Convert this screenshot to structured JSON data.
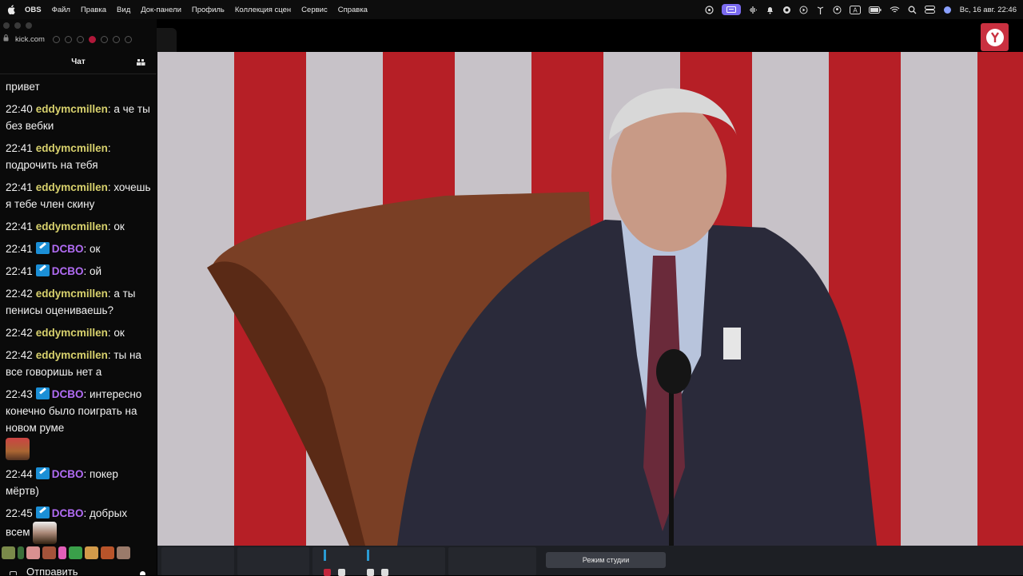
{
  "menubar": {
    "apple_icon": "apple-logo-icon",
    "app": "OBS",
    "items": [
      "Файл",
      "Правка",
      "Вид",
      "Док-панели",
      "Профиль",
      "Коллекция сцен",
      "Сервис",
      "Справка"
    ],
    "status_icons": [
      "obs-tray-icon",
      "screen-share-icon",
      "audio-wave-icon",
      "bell-icon",
      "chatgpt-icon",
      "play-circle-icon",
      "antenna-icon",
      "music-note-icon",
      "text-input-icon",
      "battery-icon",
      "wifi-icon",
      "search-icon",
      "control-center-icon",
      "siri-icon"
    ],
    "keyboard_label": "A",
    "clock": "Вс, 16 авг.  22:46"
  },
  "chat": {
    "url": "kick.com",
    "header_title": "Чат",
    "send_label": "Отправить",
    "messages": [
      {
        "text": "привет"
      },
      {
        "time": "22:40",
        "user": "eddymcmillen",
        "text": ": а че ты без вебки",
        "color": "#d8d16d"
      },
      {
        "time": "22:41",
        "user": "eddymcmillen",
        "text": ": подрочить на тебя",
        "color": "#d8d16d"
      },
      {
        "time": "22:41",
        "user": "eddymcmillen",
        "text": ": хочешь я тебе член скину",
        "color": "#d8d16d"
      },
      {
        "time": "22:41",
        "user": "eddymcmillen",
        "text": ": ок",
        "color": "#d8d16d"
      },
      {
        "time": "22:41",
        "user": "DCBO",
        "text": ": ок",
        "color": "#b26cf5",
        "badge": true
      },
      {
        "time": "22:41",
        "user": "DCBO",
        "text": ": ой",
        "color": "#b26cf5",
        "badge": true
      },
      {
        "time": "22:42",
        "user": "eddymcmillen",
        "text": ": а ты пенисы оцениваешь?",
        "color": "#d8d16d"
      },
      {
        "time": "22:42",
        "user": "eddymcmillen",
        "text": ": ок",
        "color": "#d8d16d"
      },
      {
        "time": "22:42",
        "user": "eddymcmillen",
        "text": ": ты на все говоришь нет а",
        "color": "#d8d16d"
      },
      {
        "time": "22:43",
        "user": "DCBO",
        "text": ": интересно конечно было поиграть на новом руме",
        "color": "#b26cf5",
        "badge": true,
        "emote": "bearded-face-emote"
      },
      {
        "time": "22:44",
        "user": "DCBO",
        "text": ": покер мёртв)",
        "color": "#b26cf5",
        "badge": true
      },
      {
        "time": "22:45",
        "user": "DCBO",
        "text": ": добрых всем",
        "color": "#b26cf5",
        "badge": true,
        "emote": "thinking-man-emote"
      }
    ]
  },
  "obs": {
    "studio_mode_label": "Режим студии"
  }
}
